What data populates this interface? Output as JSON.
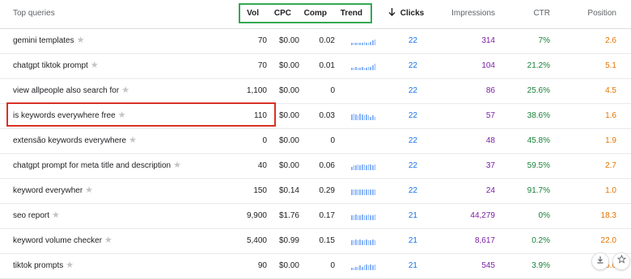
{
  "header": {
    "top_queries": "Top queries",
    "vol": "Vol",
    "cpc": "CPC",
    "comp": "Comp",
    "trend": "Trend",
    "clicks": "Clicks",
    "clicks_sort_icon": "arrow-down-icon",
    "impressions": "Impressions",
    "ctr": "CTR",
    "position": "Position"
  },
  "rows": [
    {
      "query": "gemini templates",
      "vol": "70",
      "cpc": "$0.00",
      "comp": "0.02",
      "trend": [
        2,
        2,
        2,
        2,
        2,
        2,
        3,
        2,
        2,
        3,
        4,
        5
      ],
      "clicks": "22",
      "impressions": "314",
      "ctr": "7%",
      "position": "2.6"
    },
    {
      "query": "chatgpt tiktok prompt",
      "vol": "70",
      "cpc": "$0.00",
      "comp": "0.01",
      "trend": [
        2,
        2,
        3,
        2,
        2,
        3,
        2,
        2,
        3,
        3,
        4,
        6
      ],
      "clicks": "22",
      "impressions": "104",
      "ctr": "21.2%",
      "position": "5.1"
    },
    {
      "query": "view allpeople also search for",
      "vol": "1,100",
      "cpc": "$0.00",
      "comp": "0",
      "trend": [],
      "clicks": "22",
      "impressions": "86",
      "ctr": "25.6%",
      "position": "4.5"
    },
    {
      "query": "is keywords everywhere free",
      "vol": "110",
      "cpc": "$0.00",
      "comp": "0.03",
      "trend": [
        5,
        6,
        5,
        4,
        6,
        5,
        4,
        5,
        4,
        3,
        4,
        3
      ],
      "clicks": "22",
      "impressions": "57",
      "ctr": "38.6%",
      "position": "1.6"
    },
    {
      "query": "extensão keywords everywhere",
      "vol": "0",
      "cpc": "$0.00",
      "comp": "0",
      "trend": [],
      "clicks": "22",
      "impressions": "48",
      "ctr": "45.8%",
      "position": "1.9"
    },
    {
      "query": "chatgpt prompt for meta title and description",
      "vol": "40",
      "cpc": "$0.00",
      "comp": "0.06",
      "trend": [
        3,
        4,
        4,
        5,
        4,
        5,
        5,
        4,
        5,
        5,
        4,
        5
      ],
      "clicks": "22",
      "impressions": "37",
      "ctr": "59.5%",
      "position": "2.7"
    },
    {
      "query": "keyword everywher",
      "vol": "150",
      "cpc": "$0.14",
      "comp": "0.29",
      "trend": [
        5,
        5,
        5,
        5,
        5,
        5,
        5,
        5,
        5,
        5,
        5,
        5
      ],
      "clicks": "22",
      "impressions": "24",
      "ctr": "91.7%",
      "position": "1.0"
    },
    {
      "query": "seo report",
      "vol": "9,900",
      "cpc": "$1.76",
      "comp": "0.17",
      "trend": [
        4,
        4,
        5,
        4,
        4,
        5,
        4,
        4,
        5,
        4,
        4,
        5
      ],
      "clicks": "21",
      "impressions": "44,279",
      "ctr": "0%",
      "position": "18.3"
    },
    {
      "query": "keyword volume checker",
      "vol": "5,400",
      "cpc": "$0.99",
      "comp": "0.15",
      "trend": [
        4,
        4,
        5,
        4,
        5,
        4,
        4,
        5,
        4,
        4,
        5,
        4
      ],
      "clicks": "21",
      "impressions": "8,617",
      "ctr": "0.2%",
      "position": "22.0"
    },
    {
      "query": "tiktok prompts",
      "vol": "90",
      "cpc": "$0.00",
      "comp": "0",
      "trend": [
        2,
        2,
        3,
        3,
        4,
        3,
        4,
        5,
        4,
        5,
        4,
        5
      ],
      "clicks": "21",
      "impressions": "545",
      "ctr": "3.9%",
      "position": "6.0"
    }
  ],
  "icons": {
    "star": "★",
    "download": "download-icon",
    "bookmark": "star-outline-icon"
  },
  "colors": {
    "clicks": "#1a73e8",
    "impressions": "#7b1fa2",
    "ctr": "#188038",
    "position": "#e37400",
    "highlight_green": "#34a853",
    "highlight_red": "#d93025"
  }
}
